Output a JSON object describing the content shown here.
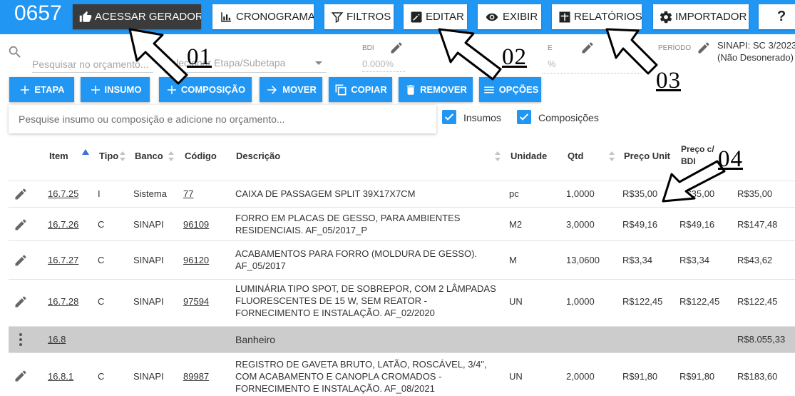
{
  "header": {
    "budget_number": "0657",
    "buttons": [
      {
        "label": "ACESSAR GERADOR",
        "icon": "thumbs-up-icon"
      },
      {
        "label": "CRONOGRAMA",
        "icon": "bar-chart-icon"
      },
      {
        "label": "FILTROS",
        "icon": "filter-icon"
      },
      {
        "label": "EDITAR",
        "icon": "edit-icon"
      },
      {
        "label": "EXIBIR",
        "icon": "eye-icon"
      },
      {
        "label": "RELATÓRIOS",
        "icon": "report-icon"
      },
      {
        "label": "IMPORTADOR",
        "icon": "gear-icon"
      },
      {
        "label": "?",
        "icon": "help-icon"
      }
    ]
  },
  "toolbar": {
    "search_placeholder": "Pesquisar no orçamento...",
    "etapa_placeholder": "Selecionar Etapa/Subetapa",
    "bdi_label": "BDI",
    "bdi_value": "0.000%",
    "second_label": "E",
    "second_value": "%",
    "periodo_label": "PERÍODO",
    "base_line1": "SINAPI: SC 3/2023",
    "base_line2": "(Não Desonerado)"
  },
  "actions": [
    {
      "label": "ETAPA",
      "icon": "plus-icon"
    },
    {
      "label": "INSUMO",
      "icon": "plus-icon"
    },
    {
      "label": "COMPOSIÇÃO",
      "icon": "plus-icon"
    },
    {
      "label": "MOVER",
      "icon": "arrow-right-icon"
    },
    {
      "label": "COPIAR",
      "icon": "copy-icon"
    },
    {
      "label": "REMOVER",
      "icon": "trash-icon"
    },
    {
      "label": "OPÇÕES",
      "icon": "menu-icon"
    }
  ],
  "add_search": {
    "placeholder": "Pesquise insumo ou composição e adicione no orçamento..."
  },
  "filters": {
    "insumos_label": "Insumos",
    "composicoes_label": "Composições"
  },
  "table": {
    "headers": {
      "item": "Item",
      "tipo": "Tipo",
      "banco": "Banco",
      "codigo": "Código",
      "descricao": "Descrição",
      "unidade": "Unidade",
      "qtd": "Qtd",
      "preco_unit": "Preço Unit",
      "preco_bdi": "Preço c/ BDI"
    },
    "rows": [
      {
        "item": "16.7.25",
        "tipo": "I",
        "banco": "Sistema",
        "codigo": "77",
        "descricao": "CAIXA DE PASSAGEM SPLIT 39X17X7CM",
        "unidade": "pc",
        "qtd": "1,0000",
        "preco_unit": "R$35,00",
        "preco_bdi": "R$35,00",
        "total": "R$35,00"
      },
      {
        "item": "16.7.26",
        "tipo": "C",
        "banco": "SINAPI",
        "codigo": "96109",
        "descricao": "FORRO EM PLACAS DE GESSO, PARA AMBIENTES RESIDENCIAIS. AF_05/2017_P",
        "unidade": "M2",
        "qtd": "3,0000",
        "preco_unit": "R$49,16",
        "preco_bdi": "R$49,16",
        "total": "R$147,48"
      },
      {
        "item": "16.7.27",
        "tipo": "C",
        "banco": "SINAPI",
        "codigo": "96120",
        "descricao": "ACABAMENTOS PARA FORRO (MOLDURA DE GESSO). AF_05/2017",
        "unidade": "M",
        "qtd": "13,0600",
        "preco_unit": "R$3,34",
        "preco_bdi": "R$3,34",
        "total": "R$43,62"
      },
      {
        "item": "16.7.28",
        "tipo": "C",
        "banco": "SINAPI",
        "codigo": "97594",
        "descricao": "LUMINÁRIA TIPO SPOT, DE SOBREPOR, COM 2 LÂMPADAS FLUORESCENTES DE 15 W, SEM REATOR - FORNECIMENTO E INSTALAÇÃO. AF_02/2020",
        "unidade": "UN",
        "qtd": "1,0000",
        "preco_unit": "R$122,45",
        "preco_bdi": "R$122,45",
        "total": "R$122,45"
      },
      {
        "item": "16.8",
        "descricao": "Banheiro",
        "total": "R$8.055,33"
      },
      {
        "item": "16.8.1",
        "tipo": "C",
        "banco": "SINAPI",
        "codigo": "89987",
        "descricao": "REGISTRO DE GAVETA BRUTO, LATÃO, ROSCÁVEL, 3/4\", COM ACABAMENTO E CANOPLA CROMADOS - FORNECIMENTO E INSTALAÇÃO. AF_08/2021",
        "unidade": "UN",
        "qtd": "2,0000",
        "preco_unit": "R$91,80",
        "preco_bdi": "R$91,80",
        "total": "R$183,60"
      }
    ]
  },
  "annotations": {
    "a1": "01",
    "a2": "02",
    "a3": "03",
    "a4": "04"
  }
}
